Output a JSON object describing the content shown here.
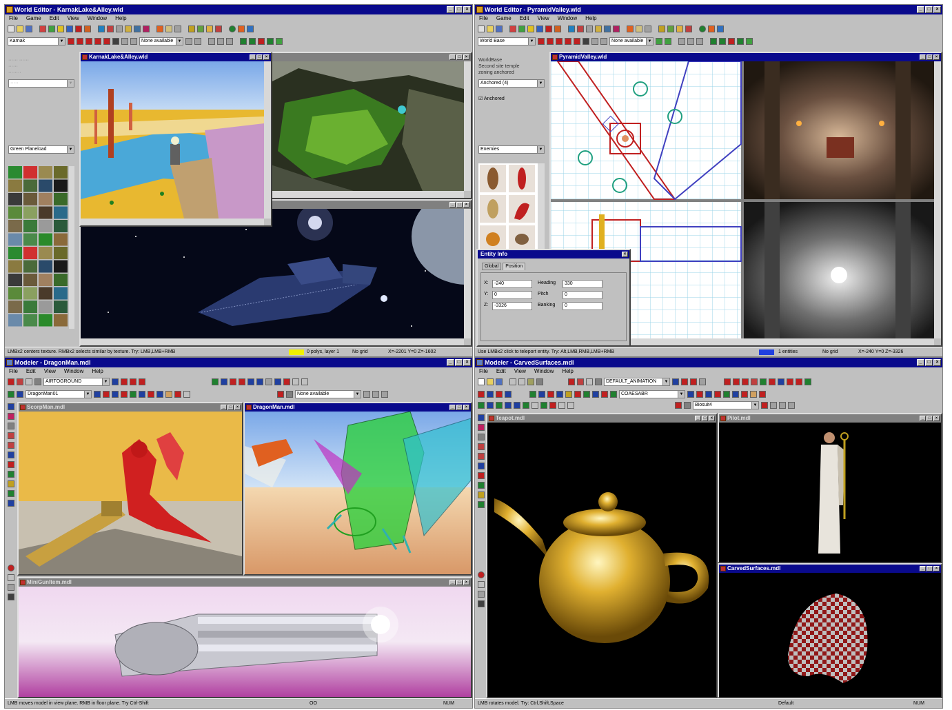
{
  "colors": {
    "title_active": "#0a0a8c",
    "title_inactive": "#808080",
    "face": "#c0c0c0",
    "pink": "#d060b0",
    "accent_red": "#c02020",
    "accent_green": "#208020"
  },
  "tl": {
    "title": "World Editor - KarnakLake&Alley.wld",
    "menu": [
      "File",
      "Game",
      "Edit",
      "View",
      "Window",
      "Help"
    ],
    "combo1": "Karnak",
    "combo2": "None available",
    "palette": "Green Planeload",
    "child_lake": "KarnakLake&Alley.wld",
    "status": {
      "hint": "LMBx2 centers texture. RMBx2 selects similar by texture. Try: LMB,LMB+RMB",
      "polys": "0 polys, layer 1",
      "grid": "No grid",
      "coords": "X=-2201 Y=0 Z=-1602"
    }
  },
  "tr": {
    "title": "World Editor - PyramidValley.wld",
    "menu": [
      "File",
      "Game",
      "Edit",
      "View",
      "Window",
      "Help"
    ],
    "combo1": "World Base",
    "combo2": "None available",
    "props": {
      "line1": "WorldBase",
      "line2": "Second site temple",
      "line3": "zoning anchored",
      "combo": "Anchored (4)",
      "check": "Anchored"
    },
    "enemies": "Enemies",
    "child_pv": "PyramidValley.wld",
    "dialog": {
      "title": "Entity Info",
      "tab1": "Global",
      "tab2": "Position",
      "x_label": "X:",
      "x": "-240",
      "y_label": "Y:",
      "y": "0",
      "z_label": "Z:",
      "z": "-3326",
      "heading_label": "Heading",
      "heading": "330",
      "pitch_label": "Pitch",
      "pitch": "0",
      "banking_label": "Banking",
      "banking": "0"
    },
    "status": {
      "hint": "Use LMBx2 click to teleport entity. Try: Alt,LMB,RMB,LMB+RMB",
      "entities": "1 entities",
      "grid": "No grid",
      "coords": "X=-240 Y=0 Z=-3326"
    }
  },
  "bl": {
    "title": "Modeler - DragonMan.mdl",
    "menu": [
      "File",
      "Edit",
      "View",
      "Window",
      "Help"
    ],
    "combo_anim": "AIRTOGROUND",
    "combo_model": "DragonMan01",
    "combo3": "None available",
    "children": {
      "scorpman": "ScorpMan.mdl",
      "dragon": "DragonMan.mdl",
      "gun": "MiniGunItem.mdl"
    },
    "status": {
      "hint": "LMB moves model in view plane. RMB in floor plane. Try Ctrl-Shift",
      "mid": "OO",
      "num": "NUM"
    }
  },
  "br": {
    "title": "Modeler - CarvedSurfaces.mdl",
    "menu": [
      "File",
      "Edit",
      "View",
      "Window",
      "Help"
    ],
    "combo_anim": "DEFAULT_ANIMATION",
    "combo_model": "COAESABR",
    "combo3": "Biosuit4",
    "children": {
      "teapot": "Teapot.mdl",
      "pilot": "Pilot.mdl",
      "carved": "CarvedSurfaces.mdl"
    },
    "status": {
      "hint": "LMB rotates model. Try: Ctrl,Shift,Space",
      "mid": "Default",
      "num": "NUM"
    }
  }
}
